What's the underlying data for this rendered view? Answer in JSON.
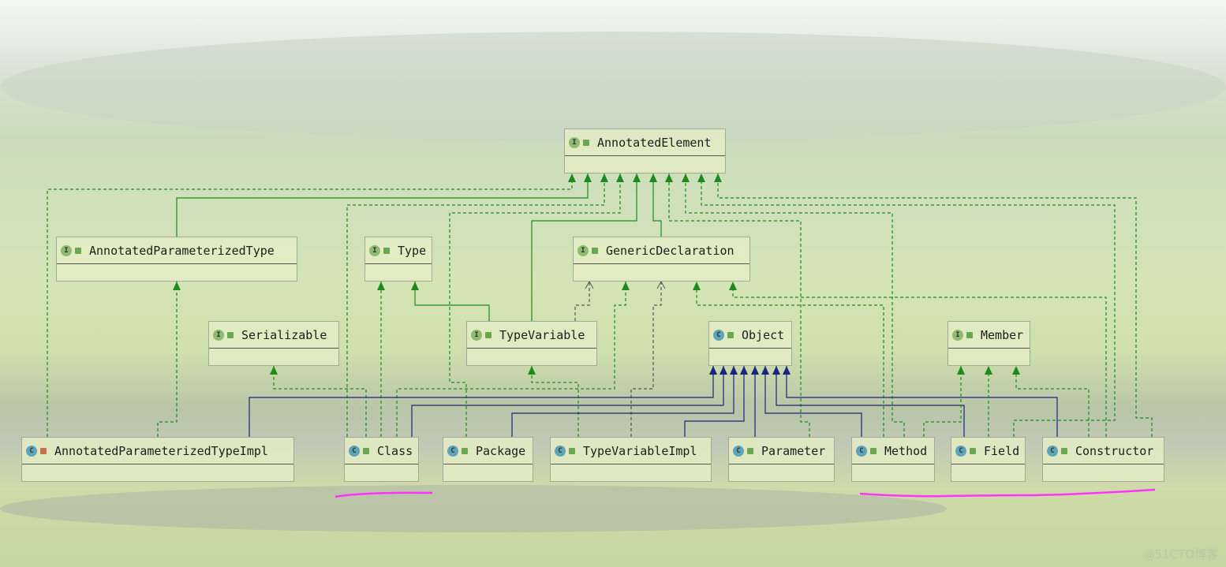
{
  "nodes": [
    {
      "name": "AnnotatedElement",
      "kind": "interface",
      "access": "public"
    },
    {
      "name": "AnnotatedParameterizedType",
      "kind": "interface",
      "access": "public"
    },
    {
      "name": "Type",
      "kind": "interface",
      "access": "public"
    },
    {
      "name": "GenericDeclaration",
      "kind": "interface",
      "access": "public"
    },
    {
      "name": "Serializable",
      "kind": "interface",
      "access": "public"
    },
    {
      "name": "TypeVariable",
      "kind": "interface",
      "access": "public"
    },
    {
      "name": "Object",
      "kind": "class",
      "access": "public"
    },
    {
      "name": "Member",
      "kind": "interface",
      "access": "public"
    },
    {
      "name": "AnnotatedParameterizedTypeImpl",
      "kind": "class",
      "access": "private"
    },
    {
      "name": "Class",
      "kind": "class",
      "access": "public"
    },
    {
      "name": "Package",
      "kind": "class",
      "access": "public"
    },
    {
      "name": "TypeVariableImpl",
      "kind": "class",
      "access": "public"
    },
    {
      "name": "Parameter",
      "kind": "class",
      "access": "public"
    },
    {
      "name": "Method",
      "kind": "class",
      "access": "public"
    },
    {
      "name": "Field",
      "kind": "class",
      "access": "public"
    },
    {
      "name": "Constructor",
      "kind": "class",
      "access": "public"
    }
  ],
  "edges": [
    {
      "from": "AnnotatedParameterizedTypeImpl",
      "to": "AnnotatedElement",
      "kind": "implements"
    },
    {
      "from": "AnnotatedParameterizedType",
      "to": "AnnotatedElement",
      "kind": "interface-extends"
    },
    {
      "from": "Class",
      "to": "AnnotatedElement",
      "kind": "implements"
    },
    {
      "from": "Package",
      "to": "AnnotatedElement",
      "kind": "implements"
    },
    {
      "from": "TypeVariable",
      "to": "AnnotatedElement",
      "kind": "interface-extends"
    },
    {
      "from": "GenericDeclaration",
      "to": "AnnotatedElement",
      "kind": "interface-extends"
    },
    {
      "from": "Parameter",
      "to": "AnnotatedElement",
      "kind": "implements"
    },
    {
      "from": "Method",
      "to": "AnnotatedElement",
      "kind": "implements"
    },
    {
      "from": "Field",
      "to": "AnnotatedElement",
      "kind": "implements"
    },
    {
      "from": "Constructor",
      "to": "AnnotatedElement",
      "kind": "implements"
    },
    {
      "from": "Class",
      "to": "Type",
      "kind": "implements"
    },
    {
      "from": "TypeVariable",
      "to": "Type",
      "kind": "interface-extends"
    },
    {
      "from": "Class",
      "to": "Serializable",
      "kind": "implements"
    },
    {
      "from": "AnnotatedParameterizedTypeImpl",
      "to": "AnnotatedParameterizedType",
      "kind": "implements"
    },
    {
      "from": "TypeVariable",
      "to": "GenericDeclaration",
      "kind": "dependency"
    },
    {
      "from": "Class",
      "to": "GenericDeclaration",
      "kind": "implements"
    },
    {
      "from": "TypeVariableImpl",
      "to": "GenericDeclaration",
      "kind": "dependency"
    },
    {
      "from": "Method",
      "to": "GenericDeclaration",
      "kind": "implements"
    },
    {
      "from": "Constructor",
      "to": "GenericDeclaration",
      "kind": "implements"
    },
    {
      "from": "TypeVariableImpl",
      "to": "TypeVariable",
      "kind": "implements"
    },
    {
      "from": "AnnotatedParameterizedTypeImpl",
      "to": "Object",
      "kind": "extends"
    },
    {
      "from": "Class",
      "to": "Object",
      "kind": "extends"
    },
    {
      "from": "Package",
      "to": "Object",
      "kind": "extends"
    },
    {
      "from": "TypeVariableImpl",
      "to": "Object",
      "kind": "extends"
    },
    {
      "from": "Parameter",
      "to": "Object",
      "kind": "extends"
    },
    {
      "from": "Method",
      "to": "Object",
      "kind": "extends"
    },
    {
      "from": "Field",
      "to": "Object",
      "kind": "extends"
    },
    {
      "from": "Constructor",
      "to": "Object",
      "kind": "extends"
    },
    {
      "from": "Method",
      "to": "Member",
      "kind": "implements"
    },
    {
      "from": "Field",
      "to": "Member",
      "kind": "implements"
    },
    {
      "from": "Constructor",
      "to": "Member",
      "kind": "implements"
    }
  ],
  "colors": {
    "implements": "#1e8a1e",
    "interface-extends": "#1e8a1e",
    "extends": "#1a237e",
    "dependency": "#555555",
    "highlight": "#ff33ff"
  },
  "highlighted": [
    "Class",
    "Method",
    "Field",
    "Constructor"
  ],
  "watermark": "@51CTO博客"
}
